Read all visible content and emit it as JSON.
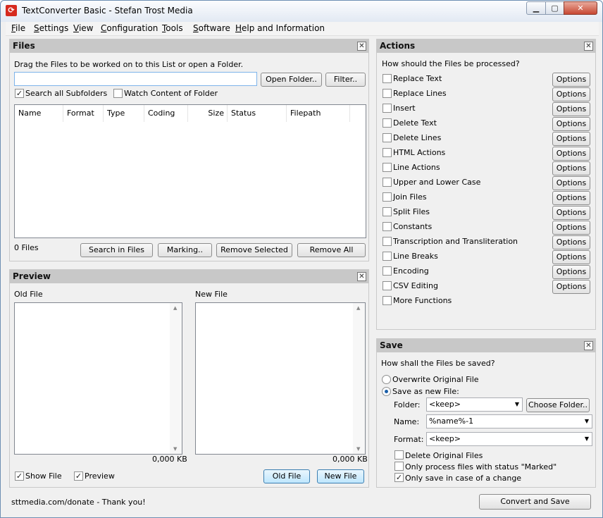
{
  "window": {
    "title": "TextConverter Basic - Stefan Trost Media",
    "icon": "app-logo-icon"
  },
  "menu": [
    {
      "k": "F",
      "r": "ile"
    },
    {
      "k": "S",
      "r": "ettings"
    },
    {
      "k": "V",
      "r": "iew"
    },
    {
      "k": "C",
      "r": "onfiguration"
    },
    {
      "k": "T",
      "r": "ools"
    },
    {
      "k": "S",
      "r": "oftware"
    },
    {
      "k": "H",
      "r": "elp and Information"
    }
  ],
  "files": {
    "title": "Files",
    "hint": "Drag the Files to be worked on to this List or open a Folder.",
    "path_value": "",
    "open_folder": "Open Folder..",
    "filter": "Filter..",
    "search_sub": "Search all Subfolders",
    "search_sub_checked": true,
    "watch": "Watch Content of Folder",
    "watch_checked": false,
    "columns": [
      "Name",
      "Format",
      "Type",
      "Coding",
      "Size",
      "Status",
      "Filepath"
    ],
    "count": "0 Files",
    "search_in_files": "Search in Files",
    "marking": "Marking..",
    "remove_selected": "Remove Selected",
    "remove_all": "Remove All"
  },
  "preview": {
    "title": "Preview",
    "old_label": "Old File",
    "new_label": "New File",
    "old_size": "0,000 KB",
    "new_size": "0,000 KB",
    "show_file": "Show File",
    "show_file_checked": true,
    "preview_chk": "Preview",
    "preview_checked": true,
    "old_btn": "Old File",
    "new_btn": "New File"
  },
  "actions": {
    "title": "Actions",
    "question": "How should the Files be processed?",
    "option_label": "Options",
    "items": [
      "Replace Text",
      "Replace Lines",
      "Insert",
      "Delete Text",
      "Delete Lines",
      "HTML Actions",
      "Line Actions",
      "Upper and Lower Case",
      "Join Files",
      "Split Files",
      "Constants",
      "Transcription and Transliteration",
      "Line Breaks",
      "Encoding",
      "CSV Editing",
      "More Functions"
    ]
  },
  "save": {
    "title": "Save",
    "question": "How shall the Files be saved?",
    "overwrite": "Overwrite Original File",
    "save_new": "Save as new File:",
    "folder_label": "Folder:",
    "folder_value": "<keep>",
    "choose_folder": "Choose Folder..",
    "name_label": "Name:",
    "name_value": "%name%-1",
    "format_label": "Format:",
    "format_value": "<keep>",
    "delete_original": "Delete Original Files",
    "only_marked": "Only process files with status \"Marked\"",
    "only_change": "Only save in case of a change",
    "only_change_checked": true
  },
  "status": {
    "text": "sttmedia.com/donate - Thank you!",
    "convert": "Convert and Save"
  }
}
